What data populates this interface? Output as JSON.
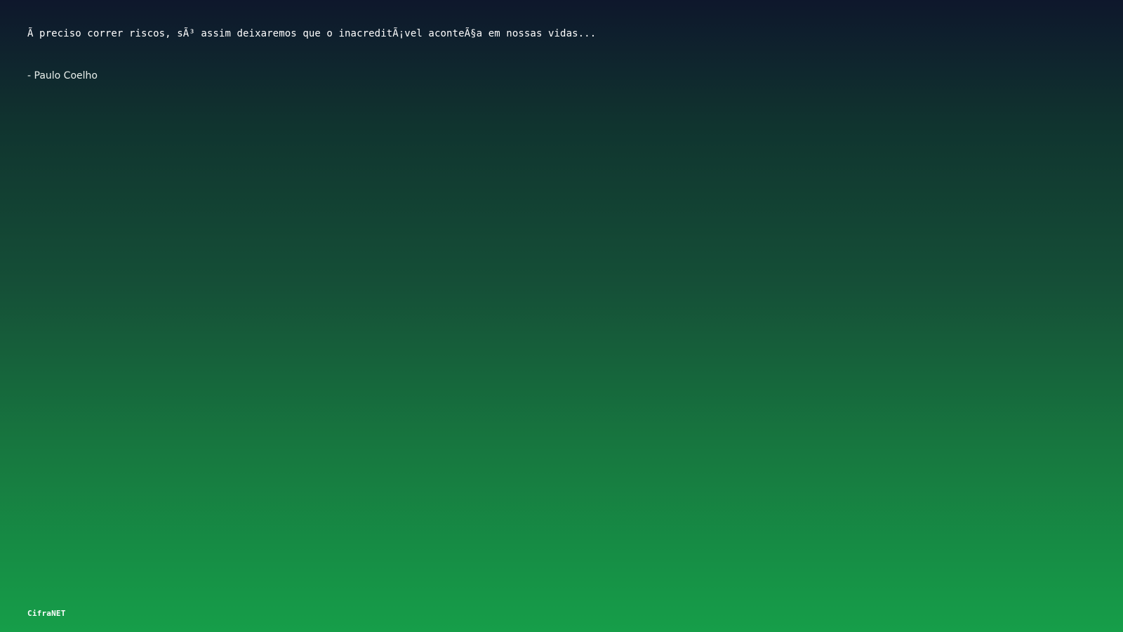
{
  "quote": {
    "text": "Ã  preciso correr riscos, sÃ³ assim deixaremos que o inacreditÃ¡vel aconteÃ§a em nossas vidas...",
    "author": "- Paulo Coelho"
  },
  "footer": {
    "brand": "CifraNET"
  },
  "colors": {
    "background_top": "#0e172c",
    "background_bottom": "#169e49",
    "text": "#ffffff"
  }
}
